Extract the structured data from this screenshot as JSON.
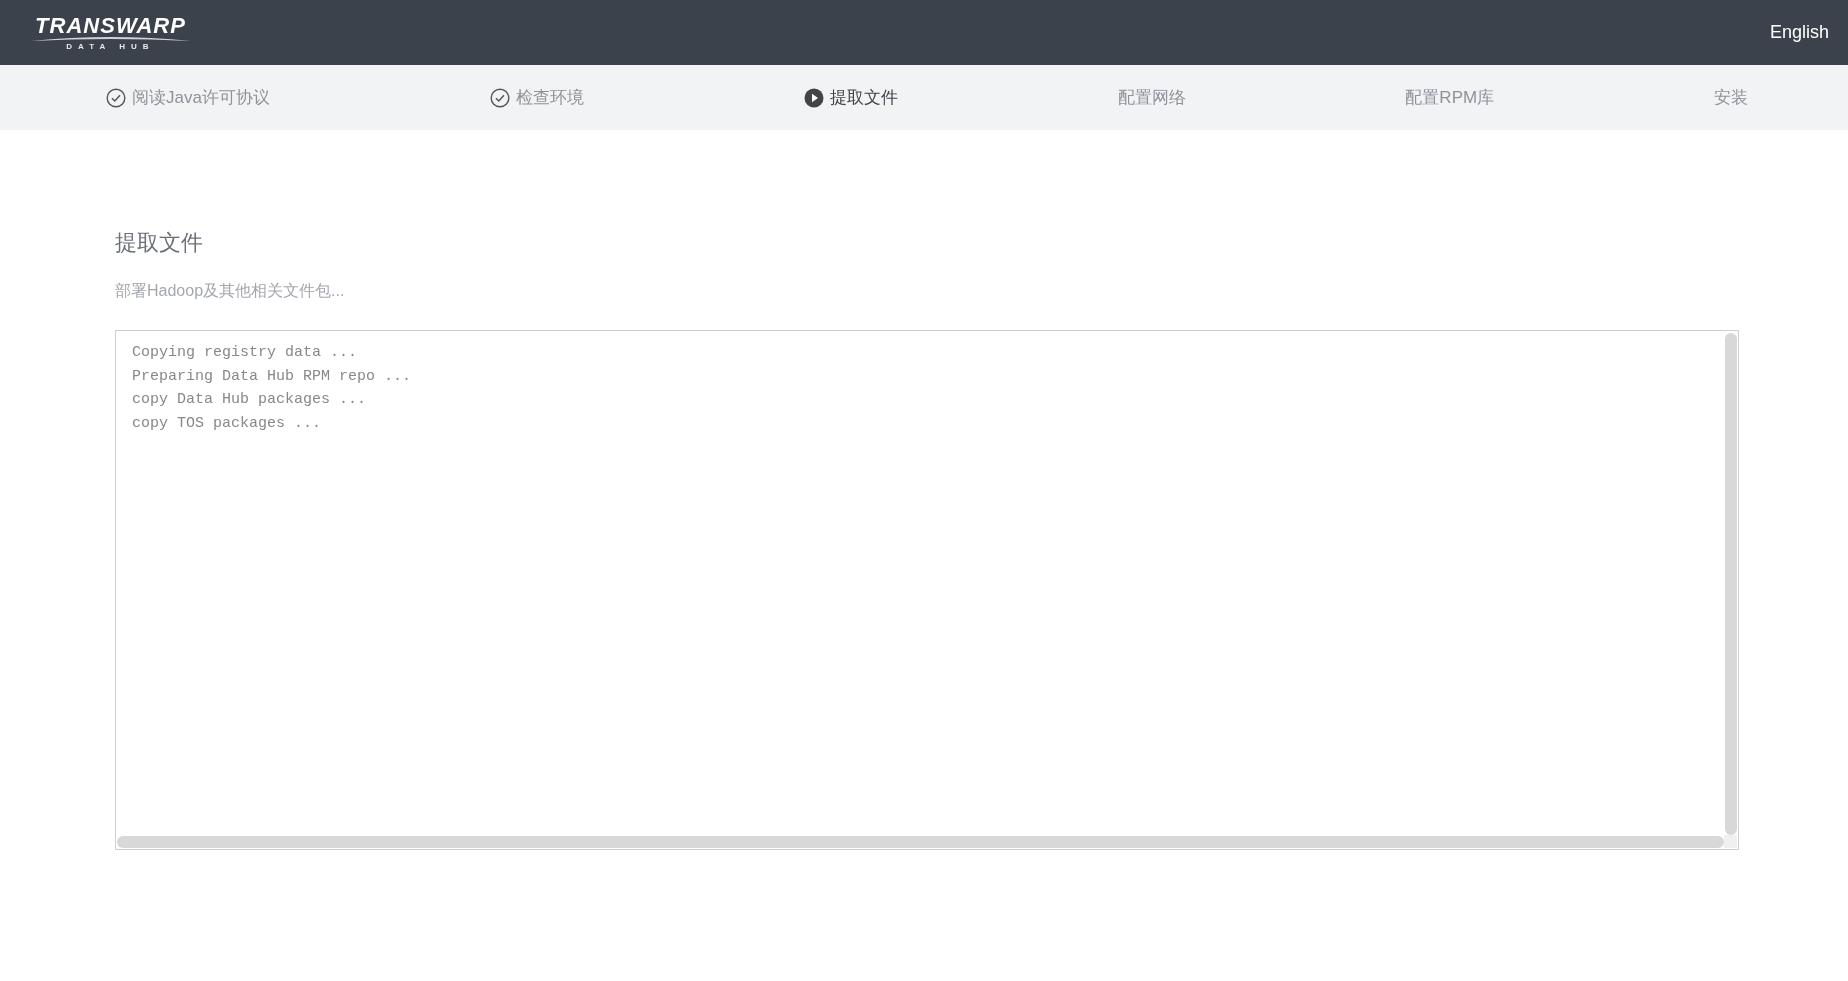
{
  "header": {
    "logo": {
      "name": "TRANSWARP",
      "subtitle": "DATA HUB"
    },
    "language": "English"
  },
  "steps": [
    {
      "label": "阅读Java许可协议",
      "kind": "done"
    },
    {
      "label": "检查环境",
      "kind": "done"
    },
    {
      "label": "提取文件",
      "kind": "current"
    },
    {
      "label": "配置网络",
      "kind": "pending"
    },
    {
      "label": "配置RPM库",
      "kind": "pending"
    },
    {
      "label": "安装",
      "kind": "pending"
    }
  ],
  "page": {
    "title": "提取文件",
    "description": "部署Hadoop及其他相关文件包...",
    "log_lines": [
      "Copying registry data ...",
      "Preparing Data Hub RPM repo ...",
      "copy Data Hub packages ...",
      "copy TOS packages ..."
    ]
  }
}
